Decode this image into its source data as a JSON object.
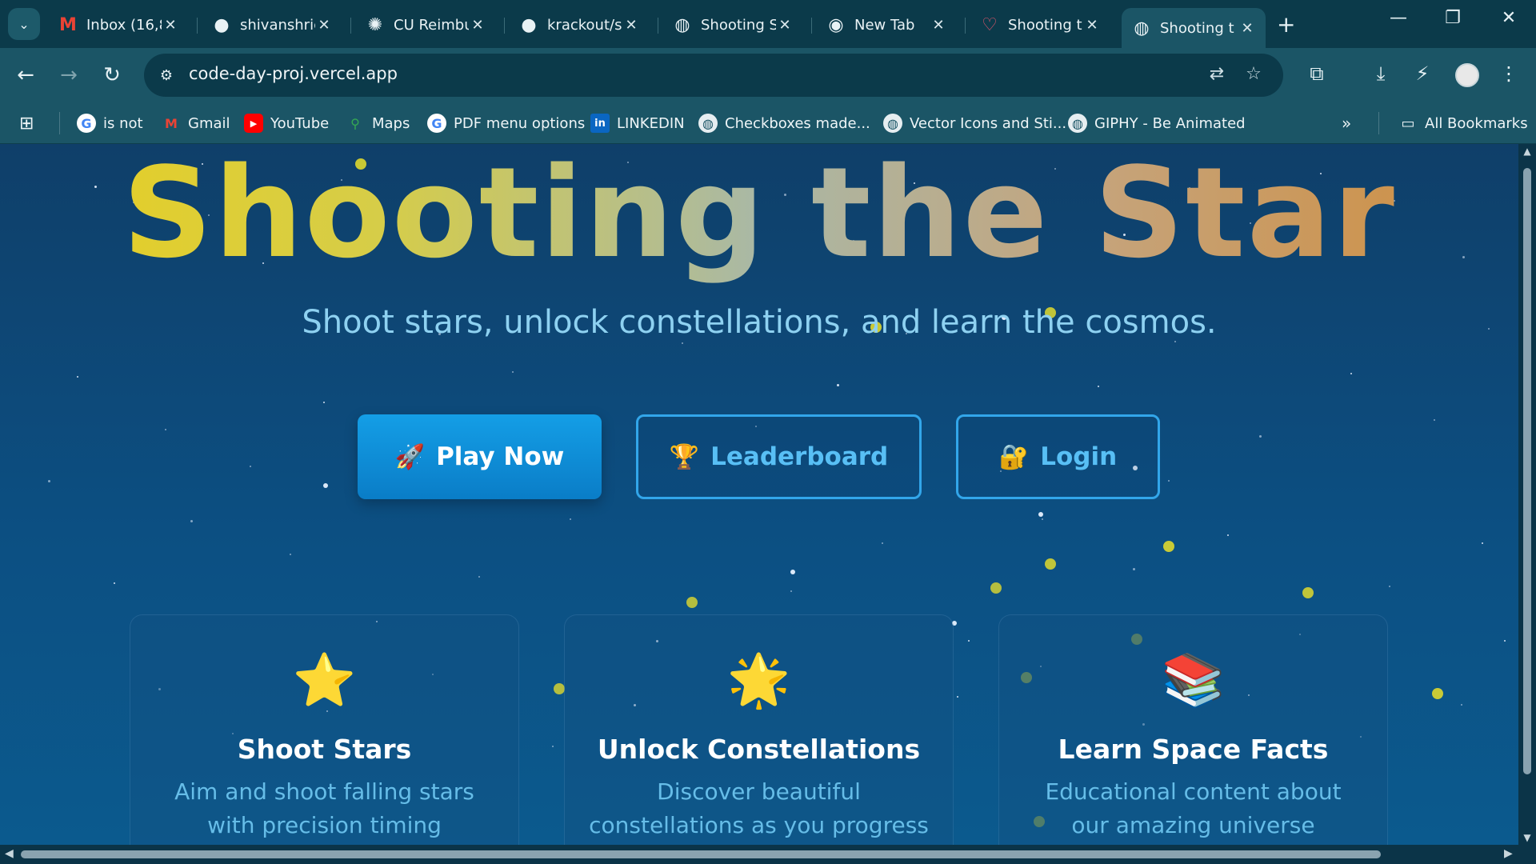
{
  "browser": {
    "tabs": [
      {
        "title": "Inbox (16,8",
        "icon": "gmail-icon",
        "active": false
      },
      {
        "title": "shivanshric",
        "icon": "github-icon",
        "active": false
      },
      {
        "title": "CU Reimbu",
        "icon": "openai-icon",
        "active": false
      },
      {
        "title": "krackout/s",
        "icon": "github-icon",
        "active": false
      },
      {
        "title": "Shooting S",
        "icon": "globe-icon",
        "active": false
      },
      {
        "title": "New Tab",
        "icon": "chrome-icon",
        "active": false
      },
      {
        "title": "Shooting t",
        "icon": "heart-icon",
        "active": false
      },
      {
        "title": "Shooting t",
        "icon": "globe-icon",
        "active": true
      }
    ],
    "address": "code-day-proj.vercel.app",
    "bookmarks": [
      {
        "label": "is not",
        "icon": "google-icon"
      },
      {
        "label": "Gmail",
        "icon": "gmail-icon"
      },
      {
        "label": "YouTube",
        "icon": "youtube-icon"
      },
      {
        "label": "Maps",
        "icon": "maps-icon"
      },
      {
        "label": "PDF menu options",
        "icon": "google-icon"
      },
      {
        "label": "LINKEDIN",
        "icon": "linkedin-icon"
      },
      {
        "label": "Checkboxes made...",
        "icon": "globe-icon"
      },
      {
        "label": "Vector Icons and Sti...",
        "icon": "globe-icon"
      },
      {
        "label": "GIPHY - Be Animated",
        "icon": "globe-icon"
      }
    ],
    "all_bookmarks": "All Bookmarks"
  },
  "hero": {
    "title": "Shooting the Star",
    "subtitle": "Shoot stars, unlock constellations, and learn the cosmos."
  },
  "actions": {
    "play": {
      "emoji": "🚀",
      "label": "Play Now"
    },
    "leaderboard": {
      "emoji": "🏆",
      "label": "Leaderboard"
    },
    "login": {
      "emoji": "🔐",
      "label": "Login"
    }
  },
  "features": [
    {
      "emoji": "⭐",
      "title": "Shoot Stars",
      "description": "Aim and shoot falling stars with precision timing"
    },
    {
      "emoji": "🌟",
      "title": "Unlock Constellations",
      "description": "Discover beautiful constellations as you progress"
    },
    {
      "emoji": "📚",
      "title": "Learn Space Facts",
      "description": "Educational content about our amazing universe"
    }
  ],
  "colors": {
    "accent": "#149ee6",
    "outline": "#32a6ea",
    "subtitle": "#8ed1f1",
    "card_text": "#66bde8"
  }
}
